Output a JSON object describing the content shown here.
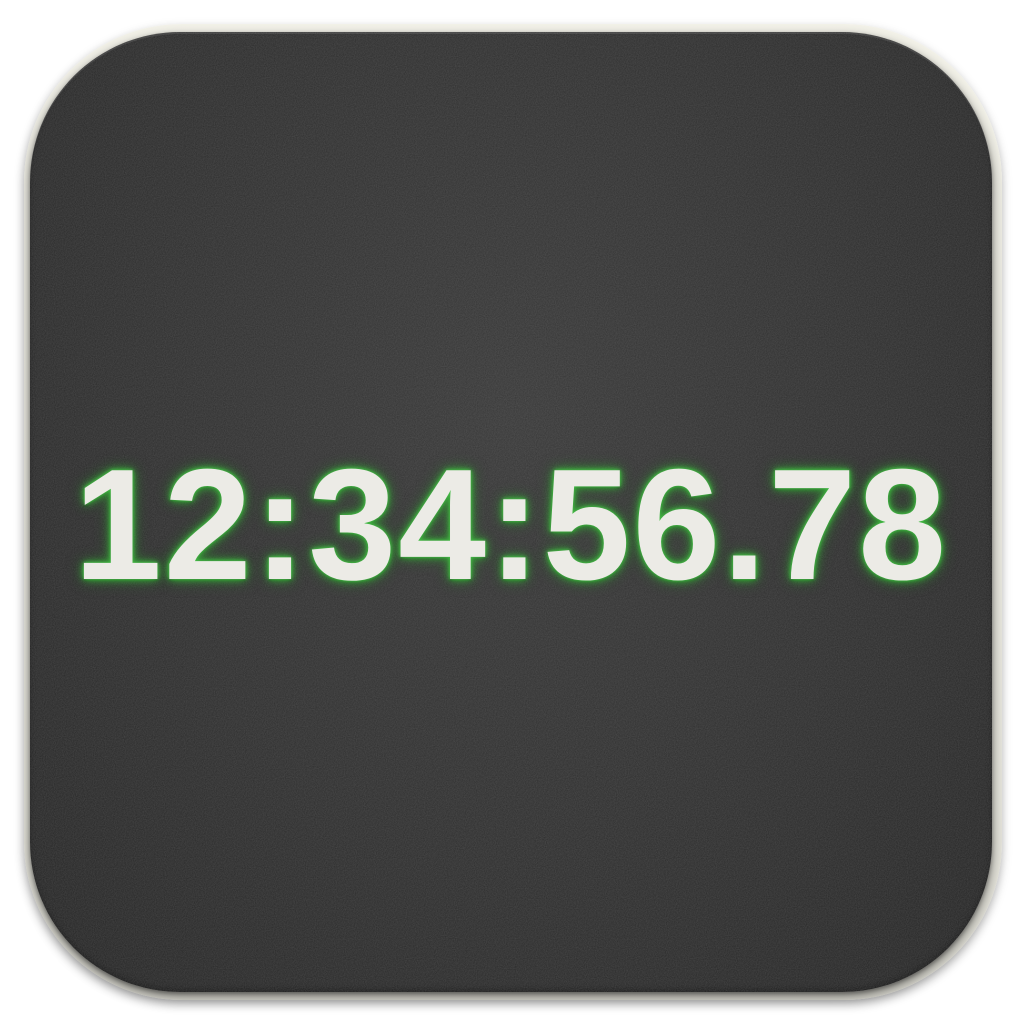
{
  "app_icon": {
    "name": "stopwatch-app-icon",
    "time_display": "12:34:56.78",
    "colors": {
      "tile_background": "#2c2c2c",
      "rim": "#f4f3ea",
      "digits": "#ecebe6",
      "glow": "#49c24a"
    }
  }
}
